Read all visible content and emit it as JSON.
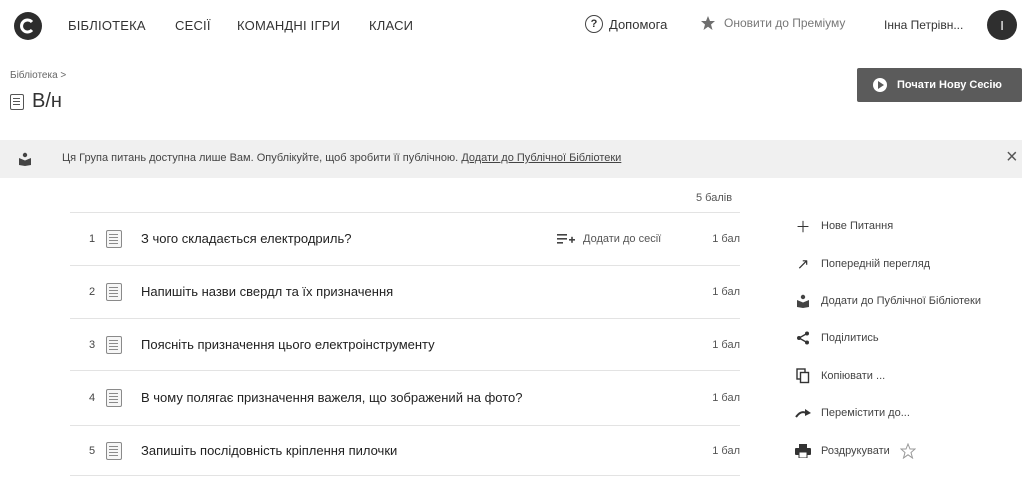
{
  "nav": {
    "items": [
      "БІБЛІОТЕКА",
      "СЕСІЇ",
      "КОМАНДНІ ІГРИ",
      "КЛАСИ"
    ],
    "help": "Допомога",
    "upgrade": "Оновити до Преміуму",
    "user": "Інна Петрівн...",
    "avatar_letter": "І"
  },
  "breadcrumb": "Бібліотека >",
  "page_title": "В/н",
  "start_button": "Почати Нову Сесію",
  "notice": {
    "text": "Ця Група питань доступна лише Вам. Опублікуйте, щоб зробити її публічною. ",
    "link": "Додати до Публічної Бібліотеки",
    "close": "×"
  },
  "total_points": "5 балів",
  "add_to_session": "Додати до сесії",
  "questions": [
    {
      "num": "1",
      "text": "З чого складається електродриль?",
      "points": "1 бал"
    },
    {
      "num": "2",
      "text": "Напишіть назви свердл та їх призначення",
      "points": "1 бал"
    },
    {
      "num": "3",
      "text": "Поясніть призначення цього електроінструменту",
      "points": "1 бал"
    },
    {
      "num": "4",
      "text": "В чому полягає призначення важеля, що зображений на фото?",
      "points": "1 бал"
    },
    {
      "num": "5",
      "text": "Запишіть послідовність кріплення пилочки",
      "points": "1 бал"
    }
  ],
  "sidebar": [
    {
      "icon": "plus-icon",
      "label": "Нове Питання"
    },
    {
      "icon": "arrow-up-right-icon",
      "label": "Попередній перегляд"
    },
    {
      "icon": "library-icon",
      "label": "Додати до Публічної Бібліотеки"
    },
    {
      "icon": "share-icon",
      "label": "Поділитись"
    },
    {
      "icon": "copy-icon",
      "label": "Копіювати ..."
    },
    {
      "icon": "move-icon",
      "label": "Перемістити до..."
    },
    {
      "icon": "print-icon",
      "label": "Роздрукувати"
    }
  ]
}
